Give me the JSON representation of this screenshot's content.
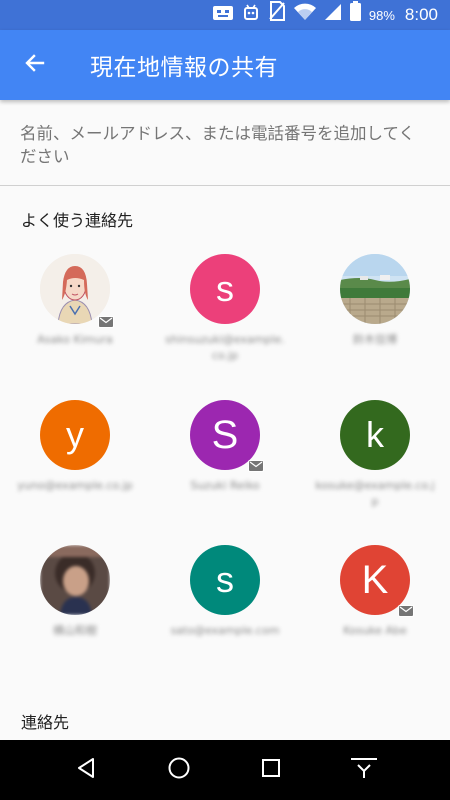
{
  "status_bar": {
    "icons": [
      "sim-card-icon",
      "android-debug-icon",
      "no-sim-icon",
      "wifi-icon",
      "signal-icon",
      "battery-icon"
    ],
    "battery_percent": "98%",
    "time": "8:00"
  },
  "header": {
    "back_icon": "arrow-back-icon",
    "title": "現在地情報の共有"
  },
  "search": {
    "hint": "名前、メールアドレス、または電話番号を追加してください"
  },
  "frequent": {
    "heading": "よく使う連絡先",
    "contacts": [
      {
        "initial": "",
        "avatar": "photo-portrait",
        "name": "Asako Kimura",
        "email_badge": true
      },
      {
        "initial": "s",
        "avatar": "#ec407a",
        "name": "shinsuzuki@example.co.jp",
        "email_badge": false
      },
      {
        "initial": "",
        "avatar": "photo-landscape",
        "name": "鈴木信博",
        "email_badge": false
      },
      {
        "initial": "y",
        "avatar": "#ef6c00",
        "name": "yuno@example.co.jp",
        "email_badge": false
      },
      {
        "initial": "S",
        "avatar": "#9c27b0",
        "name": "Suzuki Reiko",
        "email_badge": true
      },
      {
        "initial": "k",
        "avatar": "#33691e",
        "name": "kosuke@example.co.jp",
        "email_badge": false
      },
      {
        "initial": "",
        "avatar": "photo-person",
        "name": "横山和樹",
        "email_badge": false
      },
      {
        "initial": "s",
        "avatar": "#00897b",
        "name": "sato@example.com",
        "email_badge": false
      },
      {
        "initial": "K",
        "avatar": "#e04434",
        "name": "Kosuke Abe",
        "email_badge": true
      }
    ]
  },
  "contacts_section": {
    "heading": "連絡先"
  },
  "nav": {
    "icons": [
      "back-triangle-icon",
      "home-circle-icon",
      "recents-square-icon",
      "hide-keyboard-icon"
    ]
  }
}
